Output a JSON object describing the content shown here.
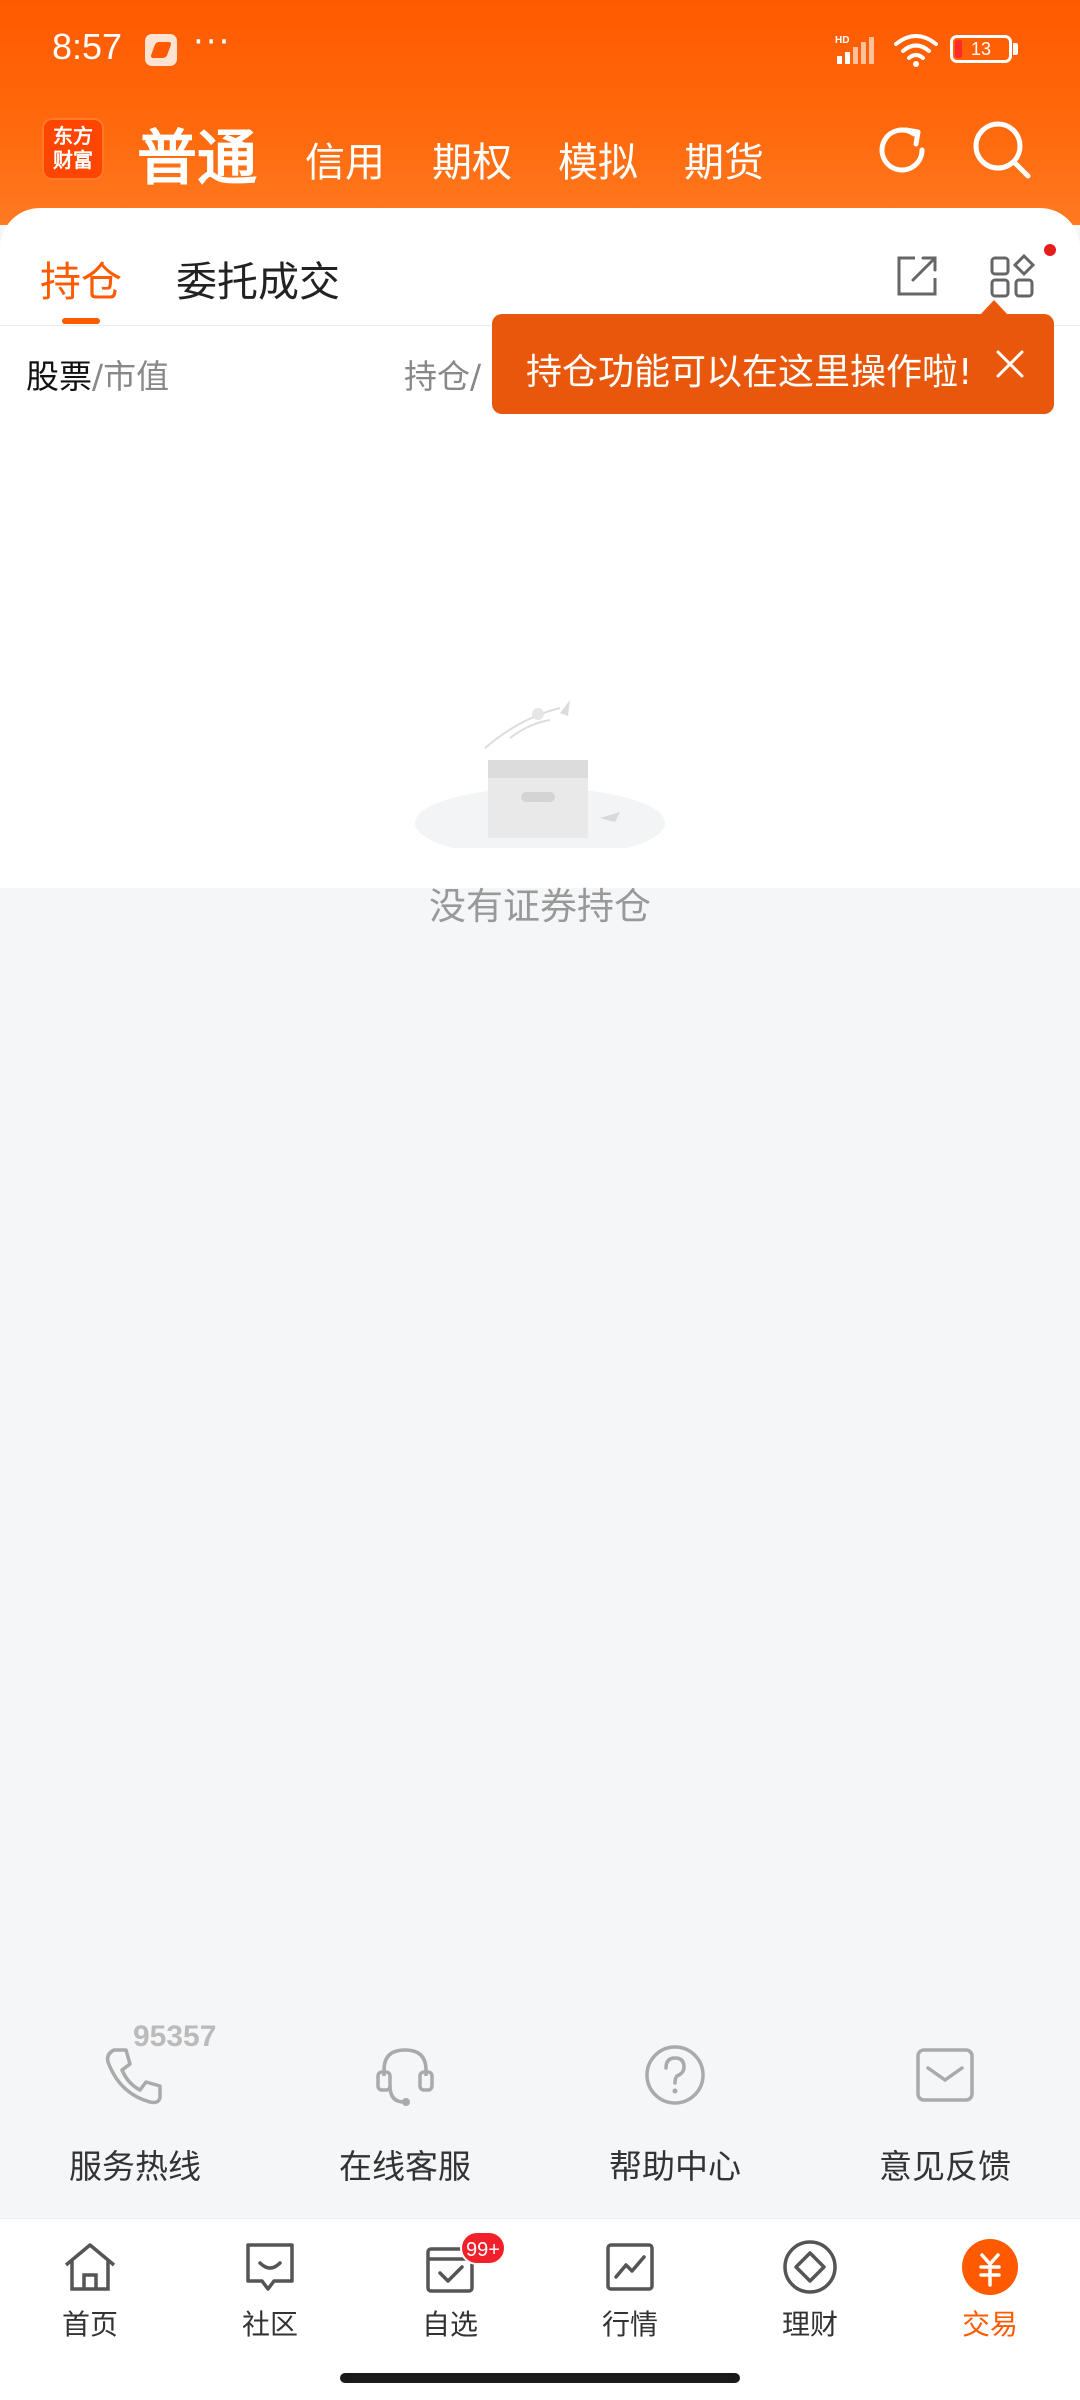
{
  "status_bar": {
    "time": "8:57",
    "more": "···",
    "network": "HD",
    "battery": "13",
    "battery_color": "#ff2b2b"
  },
  "header": {
    "logo_line1": "东方",
    "logo_line2": "财富",
    "account_tabs": [
      "普通",
      "信用",
      "期权",
      "模拟",
      "期货"
    ],
    "active_account_tab": "普通",
    "brand_color": "#ff5a00"
  },
  "panel": {
    "tabs": [
      "持仓",
      "委托成交"
    ],
    "active_tab": "持仓",
    "columns": {
      "stock_label": "股票",
      "stock_sub": "/市值",
      "holding_label": "持仓/"
    }
  },
  "tooltip": {
    "text": "持仓功能可以在这里操作啦!"
  },
  "empty_state": {
    "message": "没有证券持仓"
  },
  "services": {
    "hotline_number": "95357",
    "items": [
      {
        "label": "服务热线",
        "icon": "phone-icon"
      },
      {
        "label": "在线客服",
        "icon": "headset-icon"
      },
      {
        "label": "帮助中心",
        "icon": "help-icon"
      },
      {
        "label": "意见反馈",
        "icon": "feedback-icon"
      }
    ]
  },
  "bottom_nav": {
    "items": [
      {
        "label": "首页",
        "icon": "home-icon"
      },
      {
        "label": "社区",
        "icon": "community-icon"
      },
      {
        "label": "自选",
        "icon": "watchlist-icon",
        "badge": "99+"
      },
      {
        "label": "行情",
        "icon": "market-icon"
      },
      {
        "label": "理财",
        "icon": "wealth-icon"
      },
      {
        "label": "交易",
        "icon": "trade-icon"
      }
    ],
    "active": "交易"
  }
}
